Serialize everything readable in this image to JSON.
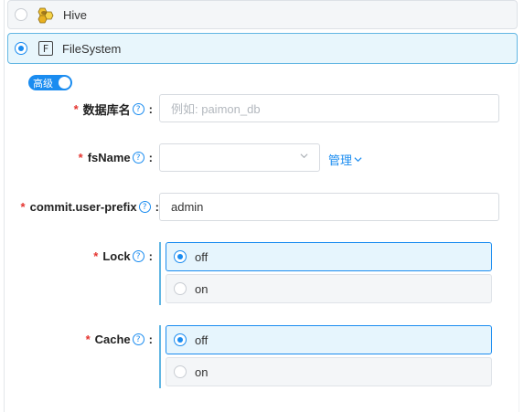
{
  "storage_options": [
    {
      "label": "Hive",
      "selected": false,
      "icon": "hive-bee-icon"
    },
    {
      "label": "FileSystem",
      "selected": true,
      "icon": "filesystem-f-icon",
      "icon_glyph": "F"
    }
  ],
  "advanced_toggle": {
    "label": "高级",
    "on": true
  },
  "form": {
    "db_name": {
      "label": "数据库名",
      "required": true,
      "help": "?",
      "colon": ":",
      "placeholder": "例如: paimon_db",
      "value": ""
    },
    "fs_name": {
      "label": "fsName",
      "required": true,
      "help": "?",
      "colon": ":",
      "value": "",
      "manage_link": "管理"
    },
    "commit_user_prefix": {
      "label": "commit.user-prefix",
      "required": true,
      "help": "?",
      "colon": ":",
      "value": "admin"
    },
    "lock": {
      "label": "Lock",
      "required": true,
      "help": "?",
      "colon": ":",
      "options": [
        "off",
        "on"
      ],
      "selected": "off"
    },
    "cache": {
      "label": "Cache",
      "required": true,
      "help": "?",
      "colon": ":",
      "options": [
        "off",
        "on"
      ],
      "selected": "off"
    }
  },
  "required_mark": "*",
  "colors": {
    "accent": "#1a8cf0",
    "required": "#e5342f",
    "selected_bg": "#e8f6fc"
  }
}
